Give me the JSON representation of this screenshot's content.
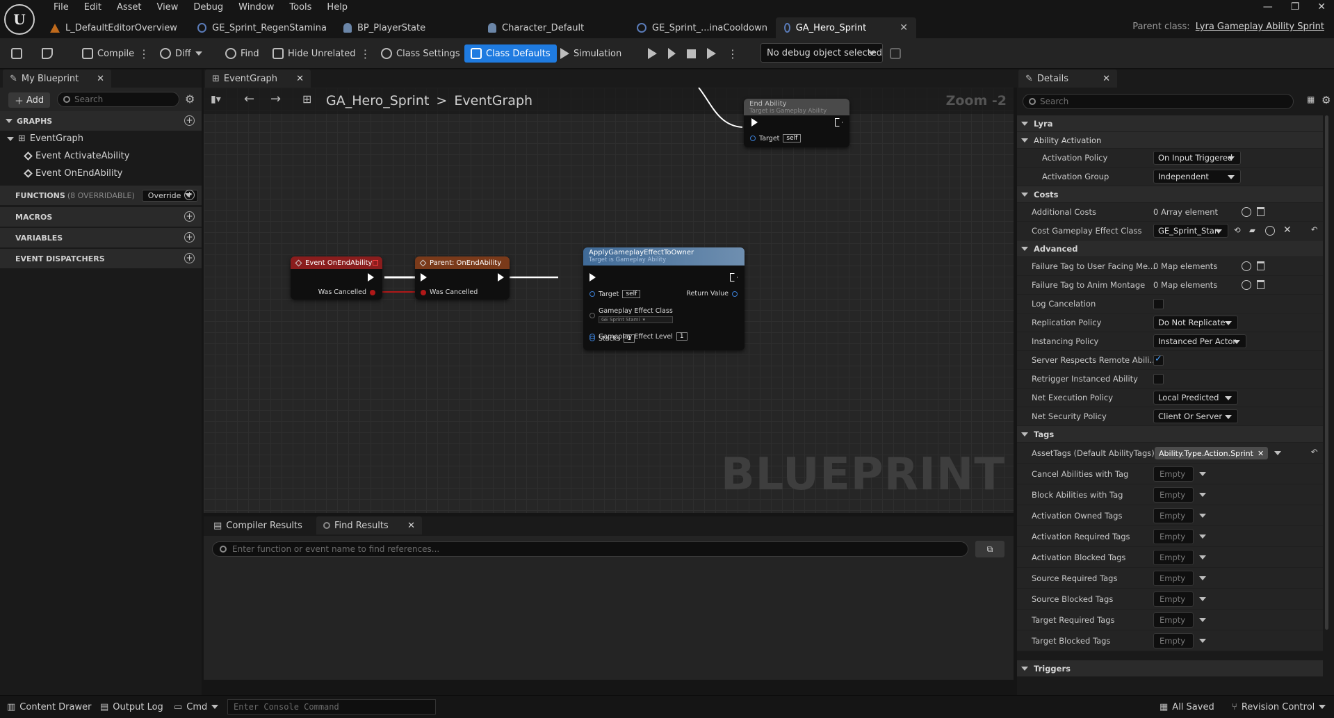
{
  "menu": [
    "File",
    "Edit",
    "Asset",
    "View",
    "Debug",
    "Window",
    "Tools",
    "Help"
  ],
  "doc_tabs": [
    {
      "label": "L_DefaultEditorOverview",
      "icon": "warning-level-icon"
    },
    {
      "label": "GE_Sprint_RegenStamina",
      "icon": "blueprint-icon"
    },
    {
      "label": "BP_PlayerState",
      "icon": "person-icon"
    },
    {
      "label": "Character_Default",
      "icon": "person-icon"
    },
    {
      "label": "GE_Sprint_...inaCooldown",
      "icon": "blueprint-icon"
    },
    {
      "label": "GA_Hero_Sprint",
      "icon": "blueprint-icon",
      "active": true
    }
  ],
  "parent_class": {
    "label": "Parent class:",
    "value": "Lyra Gameplay Ability Sprint"
  },
  "toolbar": {
    "compile": "Compile",
    "diff": "Diff",
    "find": "Find",
    "hide_unrelated": "Hide Unrelated",
    "class_settings": "Class Settings",
    "class_defaults": "Class Defaults",
    "simulation": "Simulation",
    "debug_object": "No debug object selected"
  },
  "left_panel": {
    "tab": "My Blueprint",
    "add": "Add",
    "search_placeholder": "Search",
    "graphs_header": "GRAPHS",
    "event_graph": "EventGraph",
    "events": [
      "Event ActivateAbility",
      "Event OnEndAbility"
    ],
    "functions_header": "FUNCTIONS",
    "functions_count": "(8 OVERRIDABLE)",
    "override": "Override",
    "macros_header": "MACROS",
    "variables_header": "VARIABLES",
    "dispatchers_header": "EVENT DISPATCHERS"
  },
  "graph": {
    "tab": "EventGraph",
    "breadcrumb_root": "GA_Hero_Sprint",
    "breadcrumb_sep": ">",
    "breadcrumb_leaf": "EventGraph",
    "zoom": "Zoom -2",
    "watermark": "BLUEPRINT",
    "nodes": {
      "end_ability": {
        "title": "End Ability",
        "subtitle": "Target is Gameplay Ability",
        "target_label": "Target",
        "target_value": "self"
      },
      "event_on_end": {
        "title": "Event OnEndAbility",
        "pin": "Was Cancelled"
      },
      "parent_on_end": {
        "title": "Parent: OnEndAbility",
        "pin": "Was Cancelled"
      },
      "apply_ge": {
        "title": "ApplyGameplayEffectToOwner",
        "subtitle": "Target is Gameplay Ability",
        "target_label": "Target",
        "target_value": "self",
        "return_value": "Return Value",
        "effect_class_label": "Gameplay Effect Class",
        "effect_class_value": "GE Sprint Stami",
        "level_label": "Gameplay Effect Level",
        "level_value": "1",
        "stacks_label": "Stacks",
        "stacks_value": "1"
      }
    }
  },
  "bottom": {
    "tab_compiler": "Compiler Results",
    "tab_find": "Find Results",
    "find_placeholder": "Enter function or event name to find references..."
  },
  "details": {
    "tab": "Details",
    "search_placeholder": "Search",
    "lyra": "Lyra",
    "ability_activation": "Ability Activation",
    "activation_policy_label": "Activation Policy",
    "activation_policy": "On Input Triggered",
    "activation_group_label": "Activation Group",
    "activation_group": "Independent",
    "costs": "Costs",
    "additional_costs_label": "Additional Costs",
    "additional_costs": "0 Array element",
    "cost_ge_class_label": "Cost Gameplay Effect Class",
    "cost_ge_class": "GE_Sprint_Stan",
    "advanced": "Advanced",
    "failure_tag_user_label": "Failure Tag to User Facing Me...",
    "failure_tag_user": "0 Map elements",
    "failure_tag_anim_label": "Failure Tag to Anim Montage",
    "failure_tag_anim": "0 Map elements",
    "log_cancel_label": "Log Cancelation",
    "replication_label": "Replication Policy",
    "replication": "Do Not Replicate",
    "instancing_label": "Instancing Policy",
    "instancing": "Instanced Per Actor",
    "server_respects_label": "Server Respects Remote Abili...",
    "retrigger_label": "Retrigger Instanced Ability",
    "net_exec_label": "Net Execution Policy",
    "net_exec": "Local Predicted",
    "net_security_label": "Net Security Policy",
    "net_security": "Client Or Server",
    "tags": "Tags",
    "asset_tags_label": "AssetTags (Default AbilityTags)",
    "asset_tag": "Ability.Type.Action.Sprint",
    "tag_rows": [
      "Cancel Abilities with Tag",
      "Block Abilities with Tag",
      "Activation Owned Tags",
      "Activation Required Tags",
      "Activation Blocked Tags",
      "Source Required Tags",
      "Source Blocked Tags",
      "Target Required Tags",
      "Target Blocked Tags"
    ],
    "empty": "Empty",
    "triggers": "Triggers"
  },
  "status": {
    "content_drawer": "Content Drawer",
    "output_log": "Output Log",
    "cmd": "Cmd",
    "console_placeholder": "Enter Console Command",
    "all_saved": "All Saved",
    "revision_control": "Revision Control"
  },
  "colors": {
    "accent": "#1f7be0",
    "event_header": "#8a1d1d",
    "function_header": "#4f7ca8",
    "exec_wire": "#ffffff",
    "bool_pin": "#b01818"
  }
}
